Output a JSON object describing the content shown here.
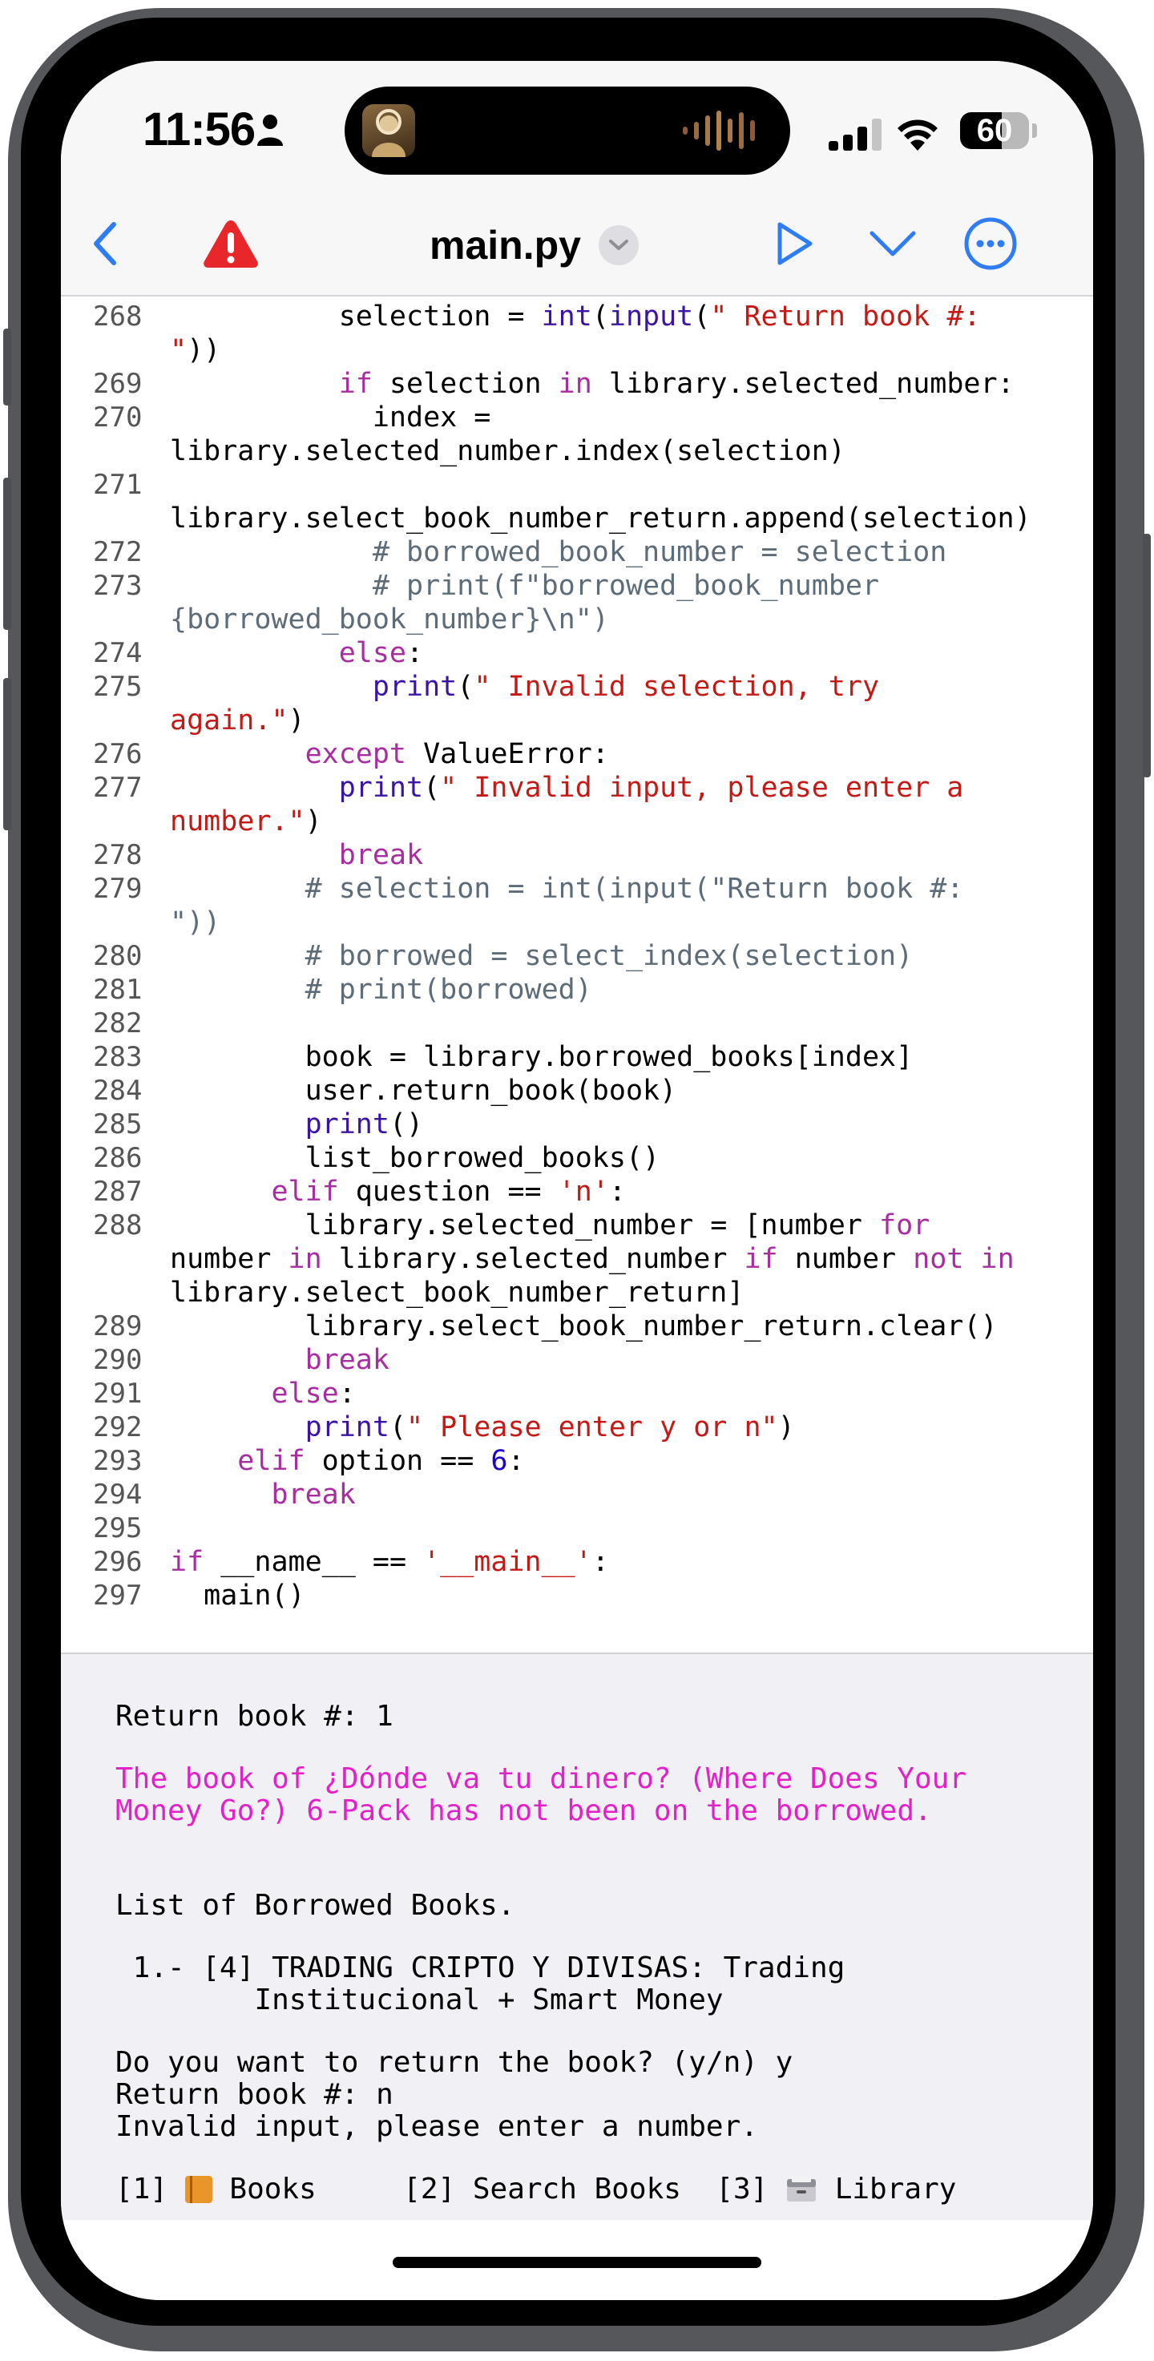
{
  "status_bar": {
    "time": "11:56",
    "battery": "60",
    "battery_level": 0.6
  },
  "toolbar": {
    "title": "main.py",
    "icons": [
      "back-chevron-icon",
      "warning-icon",
      "chevron-down-icon",
      "run-icon",
      "collapse-chevron-icon",
      "more-icon"
    ]
  },
  "editor": {
    "lines": [
      {
        "n": "268",
        "segs": [
          [
            "          selection = ",
            ""
          ],
          [
            "int",
            "bi"
          ],
          [
            "(",
            ""
          ],
          [
            "input",
            "bi"
          ],
          [
            "(",
            ""
          ],
          [
            "\" Return book #:",
            "str"
          ]
        ]
      },
      {
        "n": "",
        "segs": [
          [
            "\"",
            "str"
          ],
          [
            "))",
            ""
          ]
        ]
      },
      {
        "n": "269",
        "segs": [
          [
            "          ",
            ""
          ],
          [
            "if",
            "kw"
          ],
          [
            " selection ",
            ""
          ],
          [
            "in",
            "kw"
          ],
          [
            " library.selected_number:",
            ""
          ]
        ]
      },
      {
        "n": "270",
        "segs": [
          [
            "            index =",
            ""
          ]
        ]
      },
      {
        "n": "",
        "segs": [
          [
            "library.selected_number.index(selection)",
            ""
          ]
        ]
      },
      {
        "n": "271",
        "segs": []
      },
      {
        "n": "",
        "segs": [
          [
            "library.select_book_number_return.append(selection)",
            ""
          ]
        ]
      },
      {
        "n": "272",
        "segs": [
          [
            "            ",
            ""
          ],
          [
            "# borrowed_book_number = selection",
            "cmt"
          ]
        ]
      },
      {
        "n": "273",
        "segs": [
          [
            "            ",
            ""
          ],
          [
            "# print(f\"borrowed_book_number",
            "cmt"
          ]
        ]
      },
      {
        "n": "",
        "segs": [
          [
            "{borrowed_book_number}\\n\")",
            "cmt"
          ]
        ]
      },
      {
        "n": "274",
        "segs": [
          [
            "          ",
            ""
          ],
          [
            "else",
            "kw"
          ],
          [
            ":",
            ""
          ]
        ]
      },
      {
        "n": "275",
        "segs": [
          [
            "            ",
            ""
          ],
          [
            "print",
            "bi"
          ],
          [
            "(",
            ""
          ],
          [
            "\" Invalid selection, try",
            "str"
          ]
        ]
      },
      {
        "n": "",
        "segs": [
          [
            "again.\"",
            "str"
          ],
          [
            ")",
            ""
          ]
        ]
      },
      {
        "n": "276",
        "segs": [
          [
            "        ",
            ""
          ],
          [
            "except",
            "kw"
          ],
          [
            " ValueError:",
            ""
          ]
        ]
      },
      {
        "n": "277",
        "segs": [
          [
            "          ",
            ""
          ],
          [
            "print",
            "bi"
          ],
          [
            "(",
            ""
          ],
          [
            "\" Invalid input, please enter a",
            "str"
          ]
        ]
      },
      {
        "n": "",
        "segs": [
          [
            "number.\"",
            "str"
          ],
          [
            ")",
            ""
          ]
        ]
      },
      {
        "n": "278",
        "segs": [
          [
            "          ",
            ""
          ],
          [
            "break",
            "kw"
          ]
        ]
      },
      {
        "n": "279",
        "segs": [
          [
            "        ",
            ""
          ],
          [
            "# selection = int(input(\"Return book #:",
            "cmt"
          ]
        ]
      },
      {
        "n": "",
        "segs": [
          [
            "\"))",
            "cmt"
          ]
        ]
      },
      {
        "n": "280",
        "segs": [
          [
            "        ",
            ""
          ],
          [
            "# borrowed = select_index(selection)",
            "cmt"
          ]
        ]
      },
      {
        "n": "281",
        "segs": [
          [
            "        ",
            ""
          ],
          [
            "# print(borrowed)",
            "cmt"
          ]
        ]
      },
      {
        "n": "282",
        "segs": []
      },
      {
        "n": "283",
        "segs": [
          [
            "        book = library.borrowed_books[index]",
            ""
          ]
        ]
      },
      {
        "n": "284",
        "segs": [
          [
            "        user.return_book(book)",
            ""
          ]
        ]
      },
      {
        "n": "285",
        "segs": [
          [
            "        ",
            ""
          ],
          [
            "print",
            "bi"
          ],
          [
            "()",
            ""
          ]
        ]
      },
      {
        "n": "286",
        "segs": [
          [
            "        list_borrowed_books()",
            ""
          ]
        ]
      },
      {
        "n": "287",
        "segs": [
          [
            "      ",
            ""
          ],
          [
            "elif",
            "kw"
          ],
          [
            " question == ",
            ""
          ],
          [
            "'n'",
            "str"
          ],
          [
            ":",
            ""
          ]
        ]
      },
      {
        "n": "288",
        "segs": [
          [
            "        library.selected_number = [number ",
            ""
          ],
          [
            "for",
            "kw"
          ]
        ]
      },
      {
        "n": "",
        "segs": [
          [
            "number ",
            ""
          ],
          [
            "in",
            "kw"
          ],
          [
            " library.selected_number ",
            ""
          ],
          [
            "if",
            "kw"
          ],
          [
            " number ",
            ""
          ],
          [
            "not",
            "kw"
          ],
          [
            " ",
            ""
          ],
          [
            "in",
            "kw"
          ]
        ]
      },
      {
        "n": "",
        "segs": [
          [
            "library.select_book_number_return]",
            ""
          ]
        ]
      },
      {
        "n": "289",
        "segs": [
          [
            "        library.select_book_number_return.clear()",
            ""
          ]
        ]
      },
      {
        "n": "290",
        "segs": [
          [
            "        ",
            ""
          ],
          [
            "break",
            "kw"
          ]
        ]
      },
      {
        "n": "291",
        "segs": [
          [
            "      ",
            ""
          ],
          [
            "else",
            "kw"
          ],
          [
            ":",
            ""
          ]
        ]
      },
      {
        "n": "292",
        "segs": [
          [
            "        ",
            ""
          ],
          [
            "print",
            "bi"
          ],
          [
            "(",
            ""
          ],
          [
            "\" Please enter y or n\"",
            "str"
          ],
          [
            ")",
            ""
          ]
        ]
      },
      {
        "n": "293",
        "segs": [
          [
            "    ",
            ""
          ],
          [
            "elif",
            "kw"
          ],
          [
            " option == ",
            ""
          ],
          [
            "6",
            "num"
          ],
          [
            ":",
            ""
          ]
        ]
      },
      {
        "n": "294",
        "segs": [
          [
            "      ",
            ""
          ],
          [
            "break",
            "kw"
          ]
        ]
      },
      {
        "n": "295",
        "segs": []
      },
      {
        "n": "296",
        "segs": [
          [
            "if",
            "kw"
          ],
          [
            " __name__ == ",
            ""
          ],
          [
            "'__main__'",
            "str"
          ],
          [
            ":",
            ""
          ]
        ]
      },
      {
        "n": "297",
        "segs": [
          [
            "  main()",
            ""
          ]
        ]
      }
    ]
  },
  "console": {
    "lines": [
      {
        "t": "Return book #: 1",
        "c": ""
      },
      {
        "t": "The book of ¿Dónde va tu dinero? (Where Does Your",
        "c": "pink"
      },
      {
        "t": "Money Go?) 6-Pack has not been on the borrowed.",
        "c": "pink"
      },
      {
        "t": "List of Borrowed Books.",
        "c": ""
      },
      {
        "t": " 1.- [4] TRADING CRIPTO Y DIVISAS: Trading",
        "c": ""
      },
      {
        "t": "        Institucional + Smart Money",
        "c": ""
      },
      {
        "t": "Do you want to return the book? (y/n) y",
        "c": ""
      },
      {
        "t": "Return book #: n",
        "c": ""
      },
      {
        "t": "Invalid input, please enter a number.",
        "c": ""
      }
    ],
    "menu": [
      "[1]",
      "Books",
      "[2] Search Books",
      "[3]",
      "Library"
    ]
  }
}
